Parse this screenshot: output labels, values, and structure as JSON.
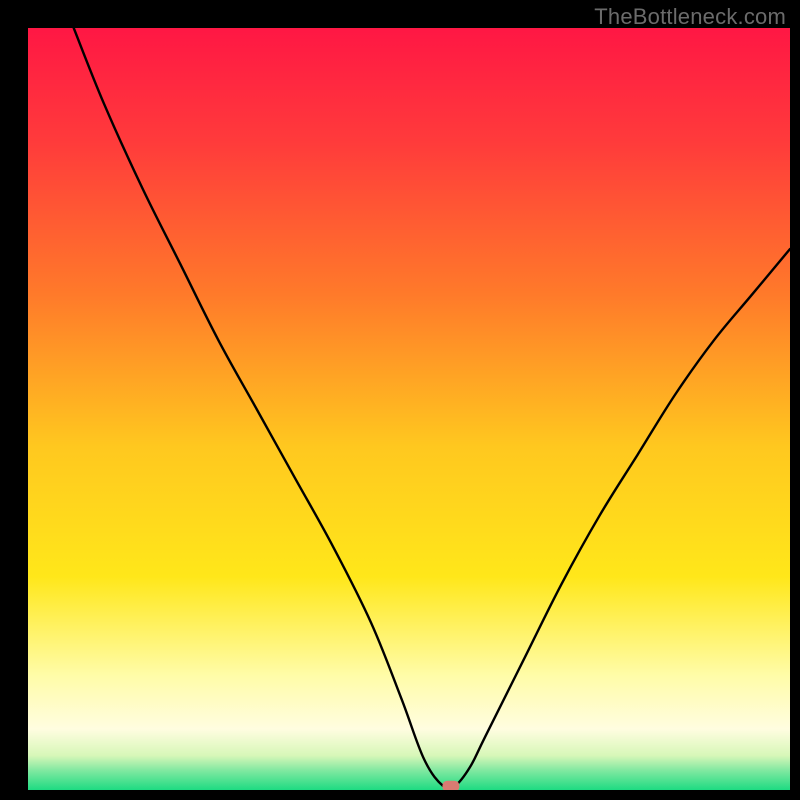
{
  "watermark": "TheBottleneck.com",
  "chart_data": {
    "type": "line",
    "title": "",
    "xlabel": "",
    "ylabel": "",
    "xlim": [
      0,
      100
    ],
    "ylim": [
      0,
      100
    ],
    "grid": false,
    "legend": false,
    "series": [
      {
        "name": "bottleneck-curve",
        "x": [
          6,
          10,
          15,
          20,
          25,
          30,
          35,
          40,
          45,
          49,
          52,
          54.5,
          56,
          58,
          60,
          65,
          70,
          75,
          80,
          85,
          90,
          95,
          100
        ],
        "y": [
          100,
          90,
          79,
          69,
          59,
          50,
          41,
          32,
          22,
          12,
          4,
          0.5,
          0.5,
          3,
          7,
          17,
          27,
          36,
          44,
          52,
          59,
          65,
          71
        ]
      }
    ],
    "marker": {
      "name": "optimal-point",
      "x": 55.5,
      "y": 0.5,
      "color": "#d87b72"
    },
    "background_gradient": {
      "stops": [
        {
          "offset": 0.0,
          "color": "#ff1744"
        },
        {
          "offset": 0.15,
          "color": "#ff3b3b"
        },
        {
          "offset": 0.35,
          "color": "#ff7a2a"
        },
        {
          "offset": 0.55,
          "color": "#ffc81f"
        },
        {
          "offset": 0.72,
          "color": "#ffe71a"
        },
        {
          "offset": 0.85,
          "color": "#fffca8"
        },
        {
          "offset": 0.92,
          "color": "#fffde0"
        },
        {
          "offset": 0.955,
          "color": "#d7f7b8"
        },
        {
          "offset": 0.975,
          "color": "#7ee8a0"
        },
        {
          "offset": 1.0,
          "color": "#1edb82"
        }
      ]
    }
  }
}
